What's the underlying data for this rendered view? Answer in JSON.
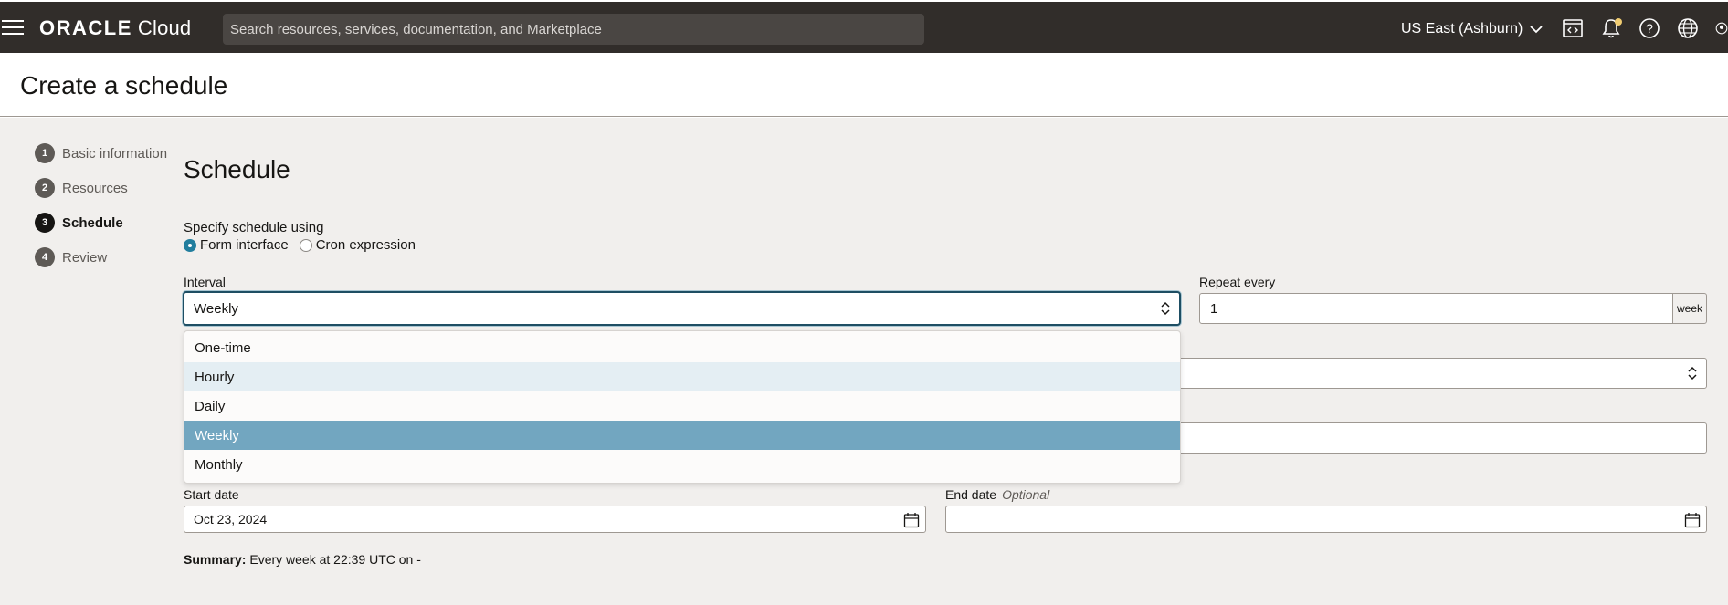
{
  "topbar": {
    "brand_word": "ORACLE",
    "brand_product": "Cloud",
    "search_placeholder": "Search resources, services, documentation, and Marketplace",
    "region": "US East (Ashburn)",
    "icons": [
      "code-editor-icon",
      "bell-icon",
      "help-icon",
      "globe-icon",
      "profile-icon"
    ],
    "notification_dot_color": "#f0cc71"
  },
  "page": {
    "title": "Create a schedule"
  },
  "steps": [
    {
      "num": "1",
      "label": "Basic information",
      "active": false
    },
    {
      "num": "2",
      "label": "Resources",
      "active": false
    },
    {
      "num": "3",
      "label": "Schedule",
      "active": true
    },
    {
      "num": "4",
      "label": "Review",
      "active": false
    }
  ],
  "schedule": {
    "section_title": "Schedule",
    "specify_label": "Specify schedule using",
    "radio_options": [
      {
        "label": "Form interface",
        "checked": true
      },
      {
        "label": "Cron expression",
        "checked": false
      }
    ],
    "interval": {
      "label": "Interval",
      "value": "Weekly",
      "options": [
        "One-time",
        "Hourly",
        "Daily",
        "Weekly",
        "Monthly"
      ],
      "hovered": "Hourly",
      "selected": "Weekly"
    },
    "repeat_every": {
      "label": "Repeat every",
      "value": "1",
      "unit": "week"
    },
    "start_date": {
      "label": "Start date",
      "value": "Oct 23, 2024"
    },
    "end_date": {
      "label": "End date",
      "optional": "Optional",
      "value": ""
    },
    "summary": {
      "label": "Summary:",
      "text": "Every week at 22:39 UTC on -"
    }
  },
  "colors": {
    "topbar_bg": "#312d2a",
    "content_bg": "#f1efed",
    "focus_border": "#1e4e63",
    "selected_option_bg": "#72a6c0",
    "hover_option_bg": "#e4eef3",
    "radio_accent": "#227e9e"
  }
}
